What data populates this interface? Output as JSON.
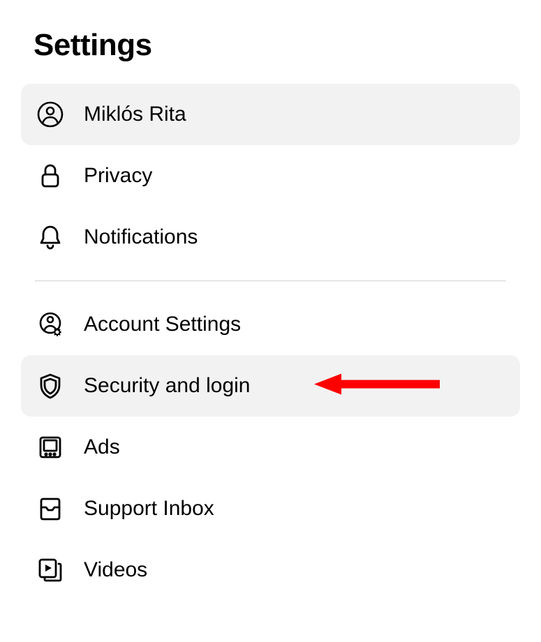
{
  "header": {
    "title": "Settings"
  },
  "group1": {
    "items": [
      {
        "label": "Miklós Rita",
        "icon": "person-icon",
        "selected": true
      },
      {
        "label": "Privacy",
        "icon": "lock-icon",
        "selected": false
      },
      {
        "label": "Notifications",
        "icon": "bell-icon",
        "selected": false
      }
    ]
  },
  "group2": {
    "items": [
      {
        "label": "Account Settings",
        "icon": "person-gear-icon",
        "selected": false
      },
      {
        "label": "Security and login",
        "icon": "shield-icon",
        "selected": true
      },
      {
        "label": "Ads",
        "icon": "monitor-icon",
        "selected": false
      },
      {
        "label": "Support Inbox",
        "icon": "inbox-icon",
        "selected": false
      },
      {
        "label": "Videos",
        "icon": "videos-icon",
        "selected": false
      }
    ]
  },
  "annotation": {
    "arrow_color": "#ff0000"
  }
}
